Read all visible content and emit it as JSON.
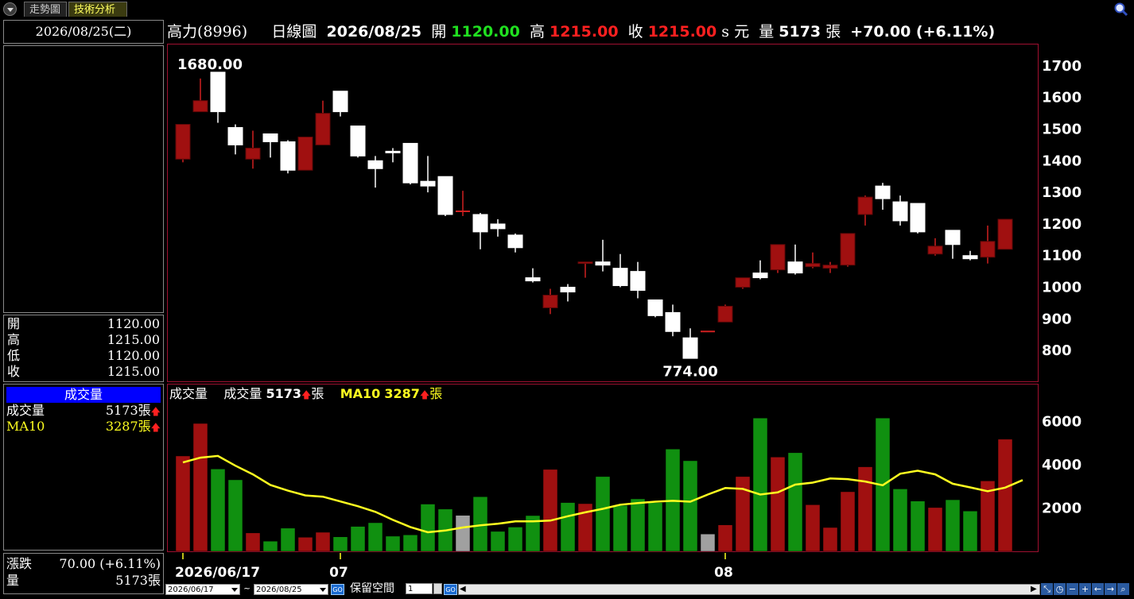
{
  "tabs": {
    "trend": "走勢圖",
    "tech": "技術分析"
  },
  "left": {
    "date": "2026/08/25(二)",
    "ohlc": [
      {
        "label": "開",
        "value": "1120.00"
      },
      {
        "label": "高",
        "value": "1215.00"
      },
      {
        "label": "低",
        "value": "1120.00"
      },
      {
        "label": "收",
        "value": "1215.00"
      }
    ],
    "volume_header": "成交量",
    "volume_rows": [
      {
        "label": "成交量",
        "value": "5173張",
        "color": "#ffffff"
      },
      {
        "label": "MA10",
        "value": "3287張",
        "color": "#ffff20"
      }
    ],
    "change_label": "漲跌",
    "change_value": "70.00 (+6.11%)",
    "qty_label": "量",
    "qty_value": "5173張"
  },
  "title": {
    "stock": "高力(8996)",
    "chart_kind": "日線圖",
    "date": "2026/08/25",
    "open_label": "開",
    "open": "1120.00",
    "high_label": "高",
    "high": "1215.00",
    "close_label": "收",
    "close": "1215.00",
    "unit": "s 元",
    "vol_label": "量",
    "vol": "5173",
    "vol_unit": "張",
    "change": "+70.00 (+6.11%)"
  },
  "vol_title": {
    "name": "成交量",
    "vol_label": "成交量",
    "vol": "5173",
    "unit": "張",
    "ma_label": "MA10",
    "ma": "3287"
  },
  "bottom": {
    "from": "2026/06/17",
    "to": "2026/08/25",
    "tilde": "~",
    "go": "GO",
    "reserve_label": "保留空間",
    "reserve_value": "1"
  },
  "colors": {
    "up": "#a01010",
    "down": "#ffffff",
    "vol_up": "#a01010",
    "vol_down": "#109010",
    "vol_flat": "#a0a0a0",
    "ma": "#ffff20",
    "frame": "#a01030"
  },
  "chart_data": [
    {
      "type": "candlestick",
      "title": "日線圖",
      "ylim": [
        720,
        1750
      ],
      "yticks": [
        800,
        900,
        1000,
        1100,
        1200,
        1300,
        1400,
        1500,
        1600,
        1700
      ],
      "x_labels": [
        {
          "index": 0,
          "text": "2026/06/17"
        },
        {
          "index": 9,
          "text": "07"
        },
        {
          "index": 31,
          "text": "08"
        }
      ],
      "annotations": [
        {
          "index": 2,
          "text": "1680.00",
          "at": "high"
        },
        {
          "index": 29,
          "text": "774.00",
          "at": "low"
        }
      ],
      "candles": [
        {
          "o": 1405,
          "h": 1515,
          "l": 1395,
          "c": 1515
        },
        {
          "o": 1555,
          "h": 1660,
          "l": 1555,
          "c": 1590
        },
        {
          "o": 1680,
          "h": 1680,
          "l": 1520,
          "c": 1555
        },
        {
          "o": 1505,
          "h": 1515,
          "l": 1420,
          "c": 1450
        },
        {
          "o": 1405,
          "h": 1495,
          "l": 1375,
          "c": 1440
        },
        {
          "o": 1485,
          "h": 1485,
          "l": 1410,
          "c": 1460
        },
        {
          "o": 1460,
          "h": 1465,
          "l": 1360,
          "c": 1370
        },
        {
          "o": 1370,
          "h": 1475,
          "l": 1370,
          "c": 1475
        },
        {
          "o": 1450,
          "h": 1590,
          "l": 1450,
          "c": 1550
        },
        {
          "o": 1620,
          "h": 1620,
          "l": 1540,
          "c": 1555
        },
        {
          "o": 1510,
          "h": 1510,
          "l": 1410,
          "c": 1415
        },
        {
          "o": 1400,
          "h": 1415,
          "l": 1315,
          "c": 1375
        },
        {
          "o": 1430,
          "h": 1440,
          "l": 1395,
          "c": 1425
        },
        {
          "o": 1455,
          "h": 1455,
          "l": 1325,
          "c": 1330
        },
        {
          "o": 1335,
          "h": 1415,
          "l": 1300,
          "c": 1320
        },
        {
          "o": 1350,
          "h": 1350,
          "l": 1225,
          "c": 1230
        },
        {
          "o": 1240,
          "h": 1305,
          "l": 1225,
          "c": 1240
        },
        {
          "o": 1230,
          "h": 1235,
          "l": 1120,
          "c": 1175
        },
        {
          "o": 1200,
          "h": 1215,
          "l": 1160,
          "c": 1185
        },
        {
          "o": 1165,
          "h": 1170,
          "l": 1110,
          "c": 1125
        },
        {
          "o": 1030,
          "h": 1060,
          "l": 1015,
          "c": 1020
        },
        {
          "o": 935,
          "h": 995,
          "l": 915,
          "c": 975
        },
        {
          "o": 1000,
          "h": 1010,
          "l": 955,
          "c": 985
        },
        {
          "o": 1075,
          "h": 1080,
          "l": 1030,
          "c": 1080
        },
        {
          "o": 1080,
          "h": 1150,
          "l": 1050,
          "c": 1070
        },
        {
          "o": 1060,
          "h": 1105,
          "l": 1000,
          "c": 1005
        },
        {
          "o": 1050,
          "h": 1080,
          "l": 965,
          "c": 990
        },
        {
          "o": 960,
          "h": 960,
          "l": 905,
          "c": 910
        },
        {
          "o": 920,
          "h": 945,
          "l": 845,
          "c": 860
        },
        {
          "o": 840,
          "h": 870,
          "l": 774,
          "c": 775
        },
        {
          "o": 860,
          "h": 860,
          "l": 860,
          "c": 860
        },
        {
          "o": 890,
          "h": 945,
          "l": 890,
          "c": 940
        },
        {
          "o": 1000,
          "h": 1030,
          "l": 995,
          "c": 1030
        },
        {
          "o": 1045,
          "h": 1085,
          "l": 1025,
          "c": 1030
        },
        {
          "o": 1055,
          "h": 1135,
          "l": 1045,
          "c": 1135
        },
        {
          "o": 1080,
          "h": 1135,
          "l": 1040,
          "c": 1045
        },
        {
          "o": 1065,
          "h": 1110,
          "l": 1060,
          "c": 1075
        },
        {
          "o": 1060,
          "h": 1080,
          "l": 1045,
          "c": 1070
        },
        {
          "o": 1070,
          "h": 1170,
          "l": 1065,
          "c": 1170
        },
        {
          "o": 1230,
          "h": 1290,
          "l": 1195,
          "c": 1285
        },
        {
          "o": 1320,
          "h": 1330,
          "l": 1245,
          "c": 1280
        },
        {
          "o": 1270,
          "h": 1290,
          "l": 1195,
          "c": 1210
        },
        {
          "o": 1265,
          "h": 1265,
          "l": 1170,
          "c": 1175
        },
        {
          "o": 1105,
          "h": 1155,
          "l": 1100,
          "c": 1130
        },
        {
          "o": 1180,
          "h": 1180,
          "l": 1090,
          "c": 1135
        },
        {
          "o": 1100,
          "h": 1115,
          "l": 1085,
          "c": 1090
        },
        {
          "o": 1095,
          "h": 1195,
          "l": 1075,
          "c": 1145
        },
        {
          "o": 1120,
          "h": 1215,
          "l": 1120,
          "c": 1215
        }
      ]
    },
    {
      "type": "bar",
      "title": "成交量",
      "ylim": [
        0,
        7000
      ],
      "yticks": [
        2000,
        4000,
        6000
      ],
      "series": [
        {
          "name": "成交量",
          "values": [
            4400,
            5900,
            3800,
            3300,
            850,
            470,
            1070,
            650,
            880,
            670,
            1150,
            1320,
            700,
            760,
            2180,
            1950,
            1660,
            2520,
            920,
            1120,
            1650,
            3780,
            2250,
            2200,
            3450,
            2120,
            2420,
            2250,
            4720,
            4180,
            800,
            1220,
            3450,
            6150,
            4350,
            4550,
            2150,
            1100,
            2750,
            3900,
            6150,
            2880,
            2320,
            2020,
            2380,
            1860,
            3250,
            5173
          ]
        },
        {
          "name": "MA10",
          "values": [
            4100,
            4320,
            4400,
            3950,
            3550,
            3060,
            2800,
            2580,
            2520,
            2300,
            2080,
            1820,
            1450,
            1120,
            880,
            960,
            1100,
            1200,
            1270,
            1380,
            1380,
            1420,
            1620,
            1800,
            1960,
            2150,
            2230,
            2290,
            2330,
            2290,
            2620,
            2920,
            2880,
            2620,
            2720,
            3080,
            3170,
            3360,
            3330,
            3220,
            3050,
            3580,
            3720,
            3550,
            3120,
            2950,
            2770,
            2940,
            3287
          ]
        }
      ]
    }
  ]
}
